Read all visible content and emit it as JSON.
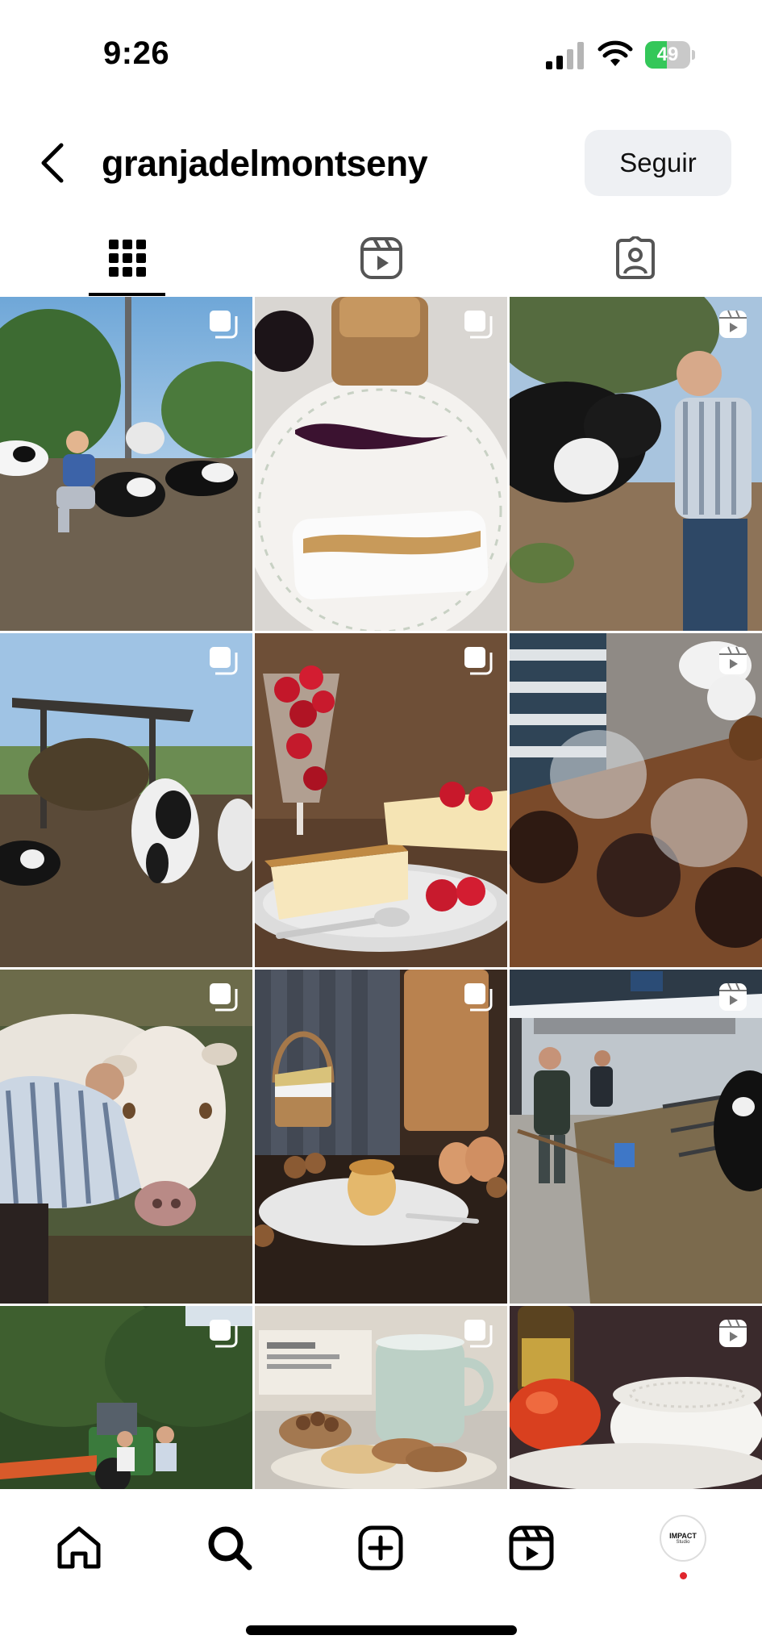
{
  "status_bar": {
    "time": "9:26",
    "battery_percent": "49",
    "battery_level": 0.49,
    "battery_color": "#34c759"
  },
  "header": {
    "username": "granjadelmontseny",
    "follow_label": "Seguir",
    "back_icon": "chevron-left-icon"
  },
  "tabs": [
    {
      "icon": "grid-icon",
      "active": true
    },
    {
      "icon": "reels-icon",
      "active": false
    },
    {
      "icon": "tagged-icon",
      "active": false
    }
  ],
  "grid": {
    "posts": [
      {
        "subject": "farmer-with-cows",
        "badge": "multiple-photos-icon"
      },
      {
        "subject": "cheese-with-jam",
        "badge": "multiple-photos-icon"
      },
      {
        "subject": "man-with-cow",
        "badge": "reels-icon"
      },
      {
        "subject": "cow-in-barn",
        "badge": "multiple-photos-icon"
      },
      {
        "subject": "cheesecake-strawberries",
        "badge": "multiple-photos-icon"
      },
      {
        "subject": "chocolate-desserts",
        "badge": "reels-icon"
      },
      {
        "subject": "man-with-white-cow",
        "badge": "multiple-photos-icon"
      },
      {
        "subject": "flan-with-eggs",
        "badge": "multiple-photos-icon"
      },
      {
        "subject": "barn-feeding",
        "badge": "reels-icon"
      },
      {
        "subject": "tractor-in-field",
        "badge": "multiple-photos-icon"
      },
      {
        "subject": "cup-and-cookies",
        "badge": "multiple-photos-icon"
      },
      {
        "subject": "tomatoes-and-cheese",
        "badge": "reels-icon"
      }
    ]
  },
  "bottom_nav": {
    "items": [
      "home-icon",
      "search-icon",
      "new-post-icon",
      "reels-icon"
    ],
    "avatar_text": "IMPACT",
    "avatar_sub": "Studio",
    "notification_color": "#e0262d"
  }
}
